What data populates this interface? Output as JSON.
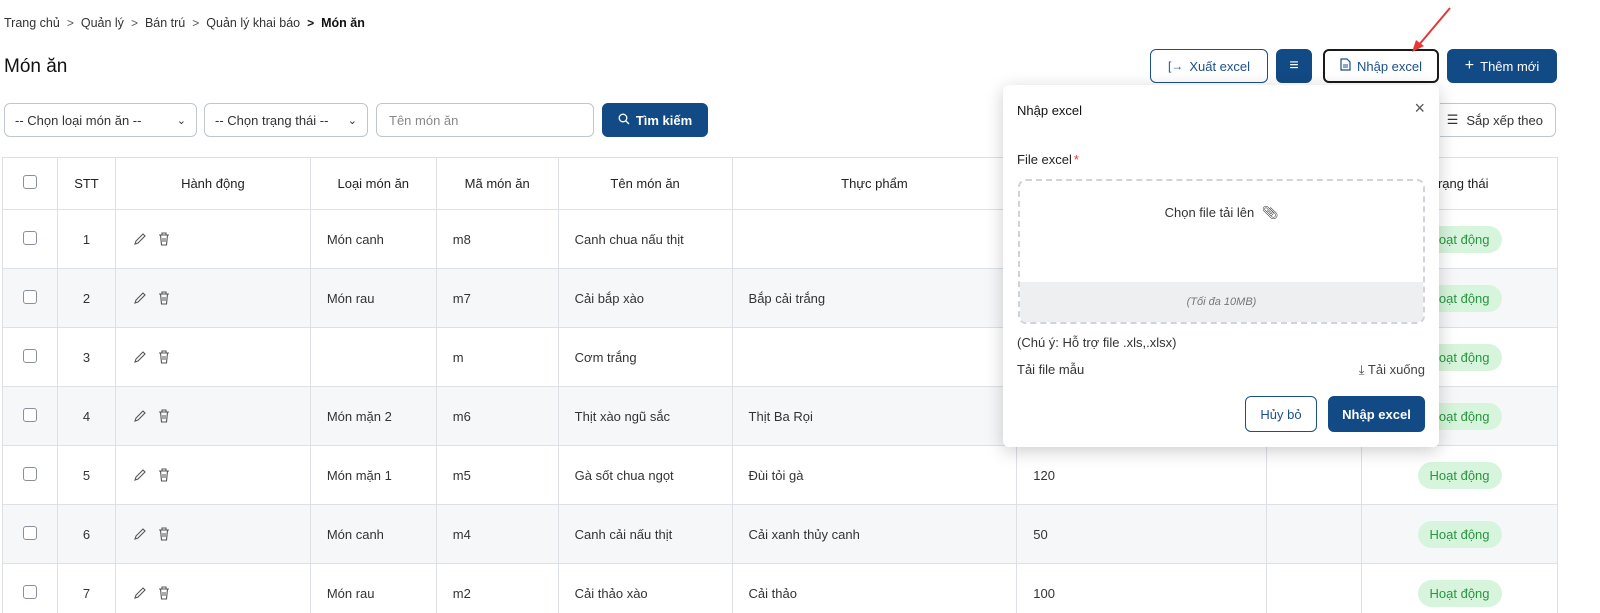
{
  "breadcrumb": [
    "Trang chủ",
    "Quản lý",
    "Bán trú",
    "Quản lý khai báo",
    "Món ăn"
  ],
  "page_title": "Món ăn",
  "toolbar": {
    "export_label": "Xuất excel",
    "import_label": "Nhập excel",
    "add_label": "Thêm mới"
  },
  "filters": {
    "type_select": "-- Chọn loại món ăn --",
    "status_select": "-- Chọn trạng thái --",
    "search_placeholder": "Tên món ăn",
    "search_button": "Tìm kiếm",
    "sort_label": "Sắp xếp theo"
  },
  "table": {
    "headers": {
      "stt": "STT",
      "actions": "Hành động",
      "type": "Loại món ăn",
      "code": "Mã món ăn",
      "name": "Tên món ăn",
      "ingredient": "Thực phẩm",
      "status": "Trạng thái"
    },
    "rows": [
      {
        "stt": "1",
        "type": "Món canh",
        "code": "m8",
        "name": "Canh chua nấu thịt",
        "ingredient": "",
        "qty": "",
        "status": "Hoạt động"
      },
      {
        "stt": "2",
        "type": "Món rau",
        "code": "m7",
        "name": "Cải bắp xào",
        "ingredient": "Bắp cải trắng",
        "qty": "",
        "status": "Hoạt động"
      },
      {
        "stt": "3",
        "type": "",
        "code": "m",
        "name": "Cơm trắng",
        "ingredient": "",
        "qty": "",
        "status": "Hoạt động"
      },
      {
        "stt": "4",
        "type": "Món mặn 2",
        "code": "m6",
        "name": "Thịt xào ngũ sắc",
        "ingredient": "Thịt Ba Rọi",
        "qty": "",
        "status": "Hoạt động"
      },
      {
        "stt": "5",
        "type": "Món mặn 1",
        "code": "m5",
        "name": "Gà sốt chua ngọt",
        "ingredient": "Đùi tỏi gà",
        "qty": "120",
        "status": "Hoạt động"
      },
      {
        "stt": "6",
        "type": "Món canh",
        "code": "m4",
        "name": "Canh cải nấu thịt",
        "ingredient": "Cải xanh thủy canh",
        "qty": "50",
        "status": "Hoạt động"
      },
      {
        "stt": "7",
        "type": "Món rau",
        "code": "m2",
        "name": "Cải thảo xào",
        "ingredient": "Cải thảo",
        "qty": "100",
        "status": "Hoạt động"
      }
    ]
  },
  "modal": {
    "title": "Nhập excel",
    "file_label": "File excel",
    "required_mark": "*",
    "dropzone_text": "Chọn file tải lên",
    "max_size": "(Tối đa 10MB)",
    "note": "(Chú ý: Hỗ trợ file .xls,.xlsx)",
    "template_label": "Tải file mẫu",
    "template_download": "Tải xuống",
    "cancel_label": "Hủy bỏ",
    "confirm_label": "Nhập excel"
  },
  "colors": {
    "primary": "#124a86",
    "badge_bg": "#d7f5dc",
    "badge_text": "#2b9442",
    "annotation_arrow": "#e53935"
  }
}
